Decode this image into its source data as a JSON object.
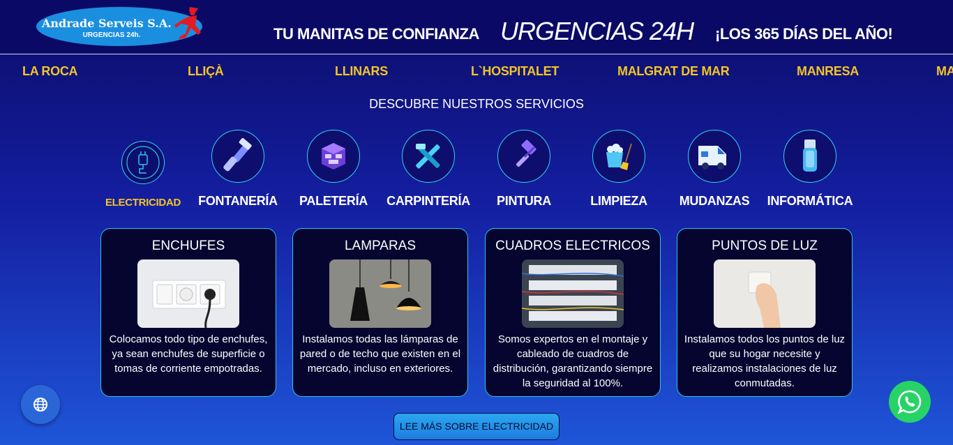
{
  "header": {
    "logo_title": "Andrade Serveis S.A.",
    "logo_subtitle": "URGENCIAS 24h.",
    "slogan_left": "TU MANITAS DE CONFIANZA",
    "slogan_center": "URGENCIAS 24H",
    "slogan_right": "¡LOS 365 DÍAS DEL AÑO!"
  },
  "towns": [
    "LA ROCA",
    "LLIÇÀ",
    "LLINARS",
    "L`HOSPITALET",
    "MALGRAT DE MAR",
    "MANRESA",
    "MA"
  ],
  "section_title": "DESCUBRE NUESTROS SERVICIOS",
  "services": [
    {
      "label": "ELECTRICIDAD",
      "icon": "plug-icon",
      "active": true
    },
    {
      "label": "FONTANERÍA",
      "icon": "wrench-icon"
    },
    {
      "label": "PALETERÍA",
      "icon": "bricks-icon"
    },
    {
      "label": "CARPINTERÍA",
      "icon": "tools-icon"
    },
    {
      "label": "PINTURA",
      "icon": "paint-roller-icon"
    },
    {
      "label": "LIMPIEZA",
      "icon": "bucket-broom-icon"
    },
    {
      "label": "MUDANZAS",
      "icon": "van-icon"
    },
    {
      "label": "INFORMÁTICA",
      "icon": "usb-icon"
    }
  ],
  "cards": [
    {
      "title": "ENCHUFES",
      "text": "Colocamos todo tipo de enchufes, ya sean enchufes de superficie o tomas de corriente empotradas."
    },
    {
      "title": "LAMPARAS",
      "text": "Instalamos todas las lámparas de pared o de techo que existen en el mercado, incluso en exteriores."
    },
    {
      "title": "CUADROS ELECTRICOS",
      "text": "Somos expertos en el montaje y cableado de cuadros de distribución, garantizando siempre la seguridad al 100%."
    },
    {
      "title": "PUNTOS DE LUZ",
      "text": "Instalamos todos los puntos de luz que su hogar necesite y realizamos instalaciones de luz conmutadas."
    }
  ],
  "more_button": "LEE MÁS SOBRE ELECTRICIDAD",
  "floating": {
    "language_icon": "globe-icon",
    "whatsapp_icon": "whatsapp-icon"
  },
  "colors": {
    "accent_yellow": "#f3c525",
    "cyan_border": "#29c7ee",
    "whatsapp_green": "#27d366",
    "header_bg": "#0a0a66"
  }
}
